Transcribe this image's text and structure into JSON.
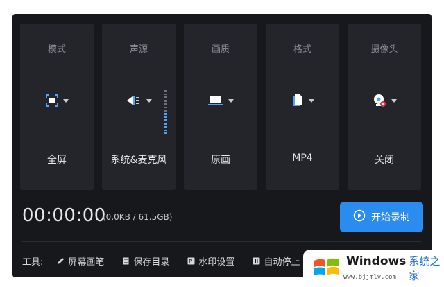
{
  "cards": [
    {
      "title": "模式",
      "value": "全屏",
      "icon": "fullscreen-icon"
    },
    {
      "title": "声源",
      "value": "系统&麦克风",
      "icon": "speaker-icon"
    },
    {
      "title": "画质",
      "value": "原画",
      "icon": "laptop-icon"
    },
    {
      "title": "格式",
      "value": "MP4",
      "icon": "file-icon"
    },
    {
      "title": "摄像头",
      "value": "关闭",
      "icon": "webcam-off-icon"
    }
  ],
  "audio_level": {
    "segments": 14,
    "active": 7
  },
  "timer": "00:00:00",
  "size_info": "(0.0KB / 61.5GB)",
  "record_button": {
    "label": "开始录制",
    "icon": "play-circle-icon"
  },
  "toolbar": {
    "label": "工具:",
    "items": [
      {
        "label": "屏幕画笔",
        "icon": "pen-icon"
      },
      {
        "label": "保存目录",
        "icon": "document-icon"
      },
      {
        "label": "水印设置",
        "icon": "watermark-icon"
      },
      {
        "label": "自动停止",
        "icon": "pause-icon"
      }
    ]
  },
  "watermark": {
    "brand": "Windows",
    "cn": "系统之家",
    "url": "www.bjjmlv.com"
  },
  "colors": {
    "accent": "#2b8cf0",
    "background": "#17181c",
    "card": "#23252b",
    "level_on": "#4fa3ff"
  }
}
